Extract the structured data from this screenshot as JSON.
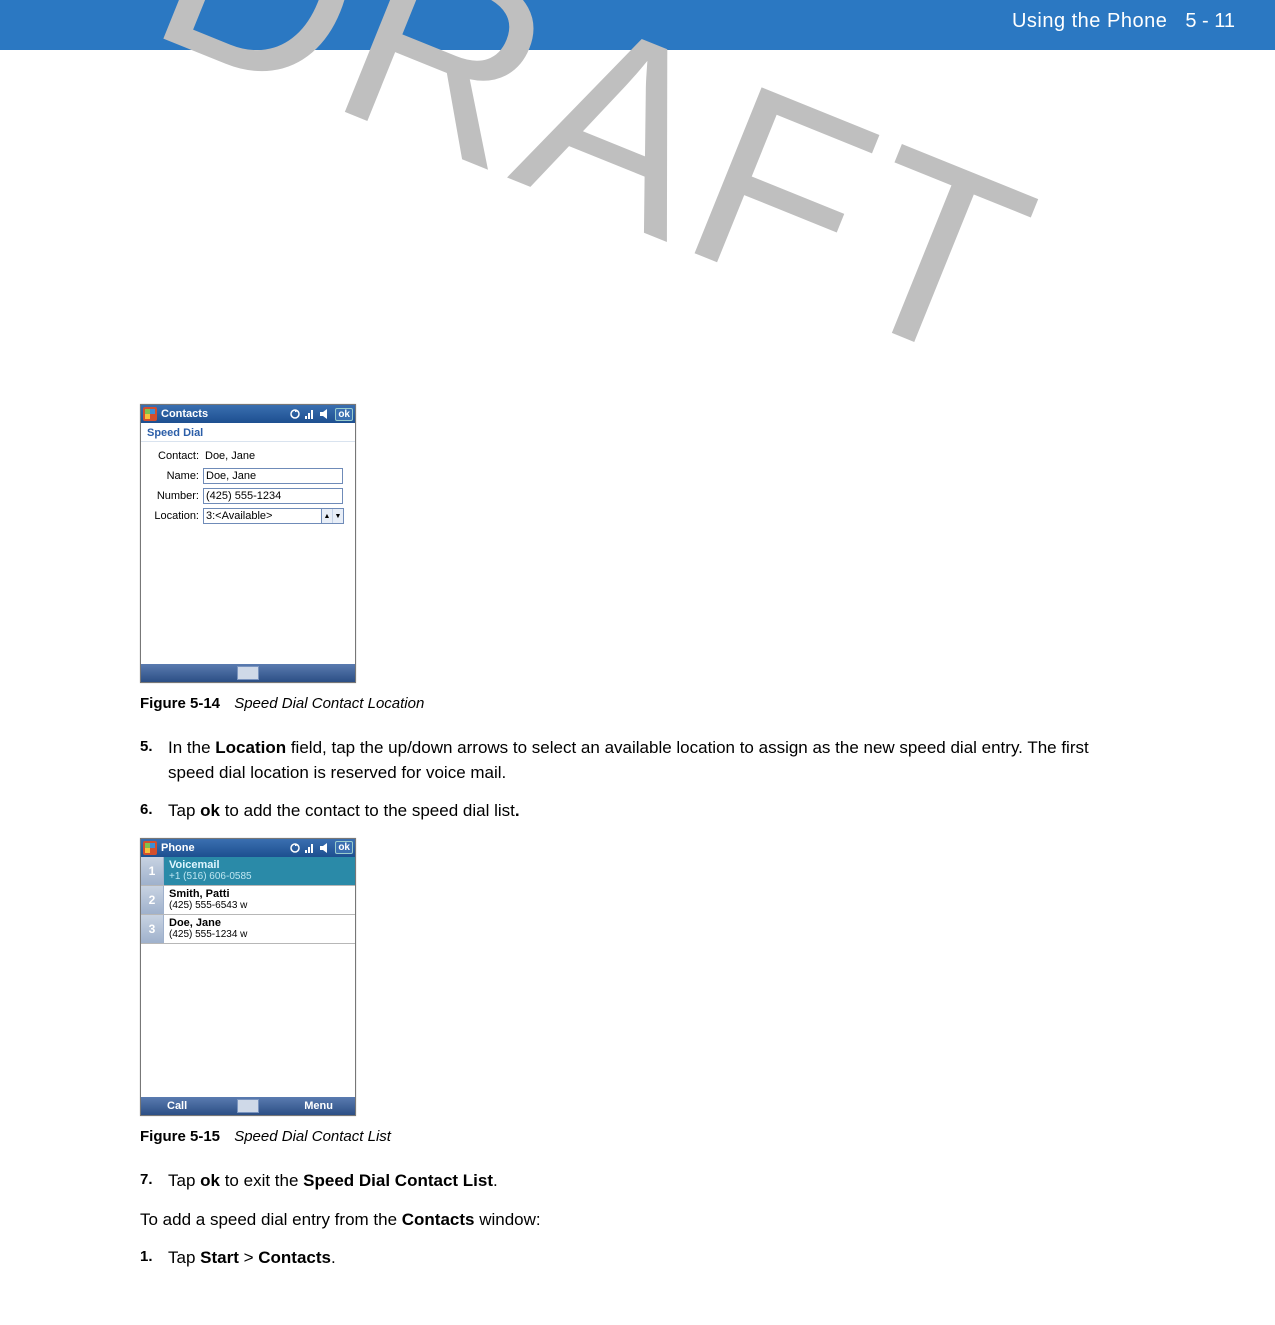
{
  "header": {
    "section_title": "Using the Phone",
    "page_number": "5 - 11"
  },
  "watermark": "DRAFT",
  "figure14": {
    "label": "Figure 5-14",
    "title": "Speed Dial Contact Location",
    "titlebar": "Contacts",
    "ok": "ok",
    "subhead": "Speed Dial",
    "form": {
      "contact_label": "Contact:",
      "contact_value": "Doe, Jane",
      "name_label": "Name:",
      "name_value": "Doe, Jane",
      "number_label": "Number:",
      "number_value": "(425) 555-1234",
      "location_label": "Location:",
      "location_value": "3:<Available>"
    }
  },
  "step5": {
    "num": "5.",
    "pre": "In the ",
    "bold1": "Location",
    "post": " field, tap the up/down arrows to select an available location to assign as the new speed dial entry. The first speed dial location is reserved for voice mail."
  },
  "step6": {
    "num": "6.",
    "pre": "Tap ",
    "bold1": "ok",
    "post": " to add the contact to the speed dial list",
    "period": "."
  },
  "figure15": {
    "label": "Figure 5-15",
    "title": "Speed Dial Contact List",
    "titlebar": "Phone",
    "ok": "ok",
    "softkey_left": "Call",
    "softkey_right": "Menu",
    "items": [
      {
        "slot": "1",
        "name": "Voicemail",
        "phone": "+1 (516) 606-0585",
        "selected": true
      },
      {
        "slot": "2",
        "name": "Smith, Patti",
        "phone": "(425) 555-6543 w",
        "selected": false
      },
      {
        "slot": "3",
        "name": "Doe, Jane",
        "phone": "(425) 555-1234 w",
        "selected": false
      }
    ]
  },
  "step7": {
    "num": "7.",
    "pre": "Tap ",
    "bold1": "ok",
    "mid": " to exit the ",
    "bold2": "Speed Dial Contact List",
    "post": "."
  },
  "para_add": {
    "pre": "To add a speed dial entry from the ",
    "bold1": "Contacts",
    "post": " window:"
  },
  "step1": {
    "num": "1.",
    "pre": "Tap ",
    "bold1": "Start",
    "mid": " > ",
    "bold2": "Contacts",
    "post": "."
  }
}
